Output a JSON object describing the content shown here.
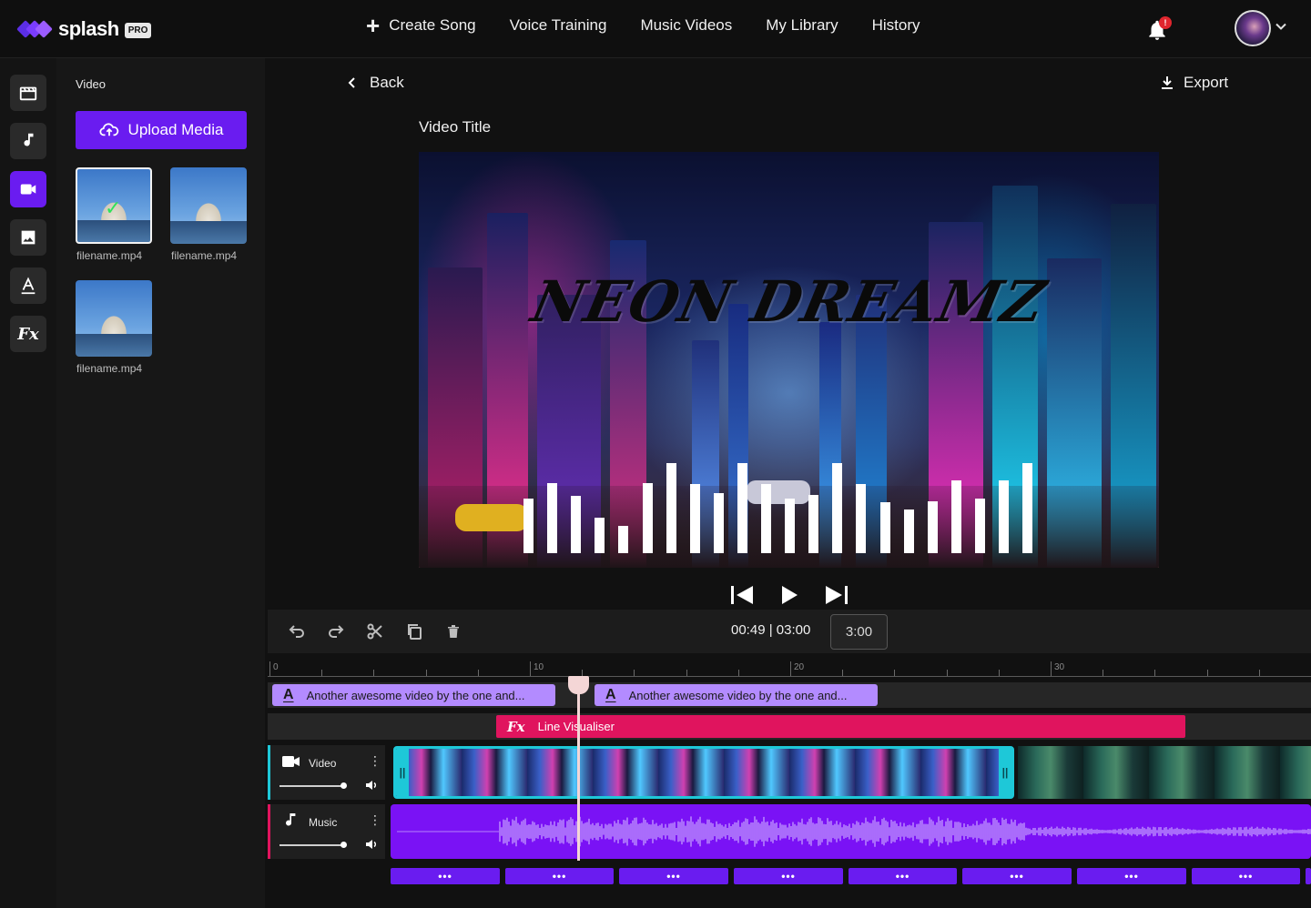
{
  "app": {
    "logo_text": "splash",
    "logo_badge": "PRO"
  },
  "nav": {
    "create_song": "Create Song",
    "voice_training": "Voice Training",
    "music_videos": "Music Videos",
    "my_library": "My Library",
    "history": "History",
    "notification_count": "!"
  },
  "rail": {
    "items": [
      "film-icon",
      "music-note-icon",
      "video-camera-icon",
      "image-icon",
      "text-icon",
      "fx-icon"
    ],
    "active": "video-camera-icon",
    "fx_label": "Fx"
  },
  "panel": {
    "title": "Video",
    "upload_label": "Upload Media",
    "media": [
      {
        "label": "filename.mp4",
        "selected": true
      },
      {
        "label": "filename.mp4",
        "selected": false
      },
      {
        "label": "filename.mp4",
        "selected": false
      }
    ]
  },
  "editor": {
    "back_label": "Back",
    "export_label": "Export",
    "video_title": "Video Title",
    "preview_text": "NEON DREAMZ",
    "visualizer_levels": [
      0.6,
      0.77,
      0.63,
      0.39,
      0.3,
      0.77,
      0.99,
      0.76,
      0.66,
      0.99,
      0.76,
      0.6,
      0.64,
      0.99,
      0.76,
      0.56,
      0.48,
      0.57,
      0.8,
      0.6,
      0.8,
      0.99
    ]
  },
  "timeline": {
    "current_time": "00:49",
    "total_time": "03:00",
    "duration": "3:00",
    "ruler_labels": [
      "0",
      "10",
      "20",
      "30"
    ],
    "text_clips": [
      "Another awesome video by the one and...",
      "Another awesome video by the one and..."
    ],
    "fx_clip": {
      "icon": "Fx",
      "label": "Line Visualiser"
    },
    "tracks": {
      "video": {
        "name": "Video",
        "volume": 1.0
      },
      "music": {
        "name": "Music",
        "volume": 1.0
      }
    },
    "segment_label": "•••",
    "colors": {
      "accent": "#6a1cf0",
      "text_clip": "#b38bff",
      "fx_clip": "#e0145e",
      "video_clip_border": "#1ec8d8",
      "music_clip": "#7a12f5"
    }
  }
}
